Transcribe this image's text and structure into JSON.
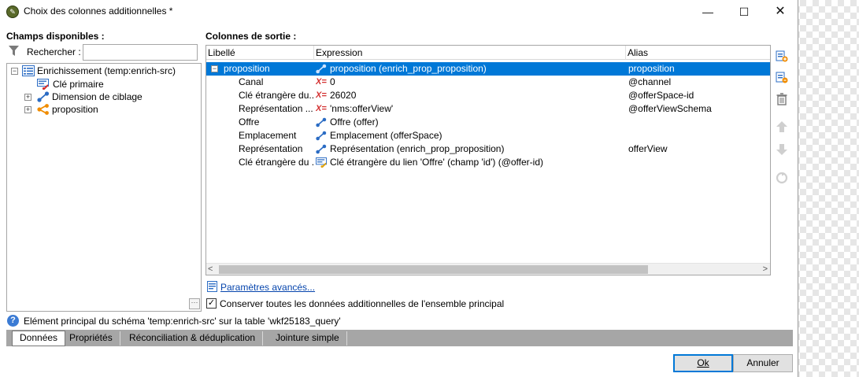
{
  "window": {
    "title": "Choix des colonnes additionnelles *"
  },
  "left_panel": {
    "heading": "Champs disponibles :",
    "search_label": "Rechercher :",
    "search_value": "",
    "tree": [
      {
        "label": "Enrichissement (temp:enrich-src)",
        "icon": "list-icon",
        "expander": "minus"
      },
      {
        "label": "Clé primaire",
        "icon": "primary-key-icon",
        "expander": ""
      },
      {
        "label": "Dimension de ciblage",
        "icon": "link-icon",
        "expander": "plus"
      },
      {
        "label": "proposition",
        "icon": "share-icon",
        "expander": "plus"
      }
    ]
  },
  "right_panel": {
    "heading": "Colonnes de sortie :",
    "columns": [
      "Libellé",
      "Expression",
      "Alias"
    ],
    "rows": [
      {
        "label": "proposition",
        "expr_icon": "link-icon",
        "expression": "proposition (enrich_prop_proposition)",
        "alias": "proposition",
        "selected": true
      },
      {
        "label": "Canal",
        "expr_icon": "expression-icon",
        "expression": "0",
        "alias": "@channel"
      },
      {
        "label": "Clé étrangère du...",
        "expr_icon": "expression-icon",
        "expression": "26020",
        "alias": "@offerSpace-id"
      },
      {
        "label": "Représentation ...",
        "expr_icon": "expression-icon",
        "expression": "'nms:offerView'",
        "alias": "@offerViewSchema"
      },
      {
        "label": "Offre",
        "expr_icon": "link-icon",
        "expression": "Offre (offer)",
        "alias": ""
      },
      {
        "label": "Emplacement",
        "expr_icon": "link-icon",
        "expression": "Emplacement (offerSpace)",
        "alias": ""
      },
      {
        "label": "Représentation",
        "expr_icon": "link-icon",
        "expression": "Représentation (enrich_prop_proposition)",
        "alias": "offerView"
      },
      {
        "label": "Clé étrangère du ...",
        "expr_icon": "foreign-key-icon",
        "expression": "Clé étrangère du lien 'Offre' (champ 'id') (@offer-id)",
        "alias": ""
      }
    ],
    "expr_marker": "X=",
    "advanced_link": "Paramètres avancés...",
    "keep_all_label": "Conserver toutes les données additionnelles de l'ensemble principal",
    "keep_all_checked": true
  },
  "toolbar_icons": [
    "add-column-icon",
    "add-column-alt-icon",
    "delete-icon",
    "move-up-icon",
    "move-down-icon",
    "refresh-icon"
  ],
  "status": {
    "text": "Elément principal du schéma 'temp:enrich-src' sur la table 'wkf25183_query'"
  },
  "tabs": [
    "Données",
    "Propriétés",
    "Réconciliation & déduplication",
    "Jointure simple"
  ],
  "buttons": {
    "ok": "Ok",
    "cancel": "Annuler"
  },
  "colors": {
    "selection": "#0078d7",
    "link": "#0645ad",
    "expression_marker": "#d32f2f",
    "tabbar": "#a6a6a6"
  }
}
